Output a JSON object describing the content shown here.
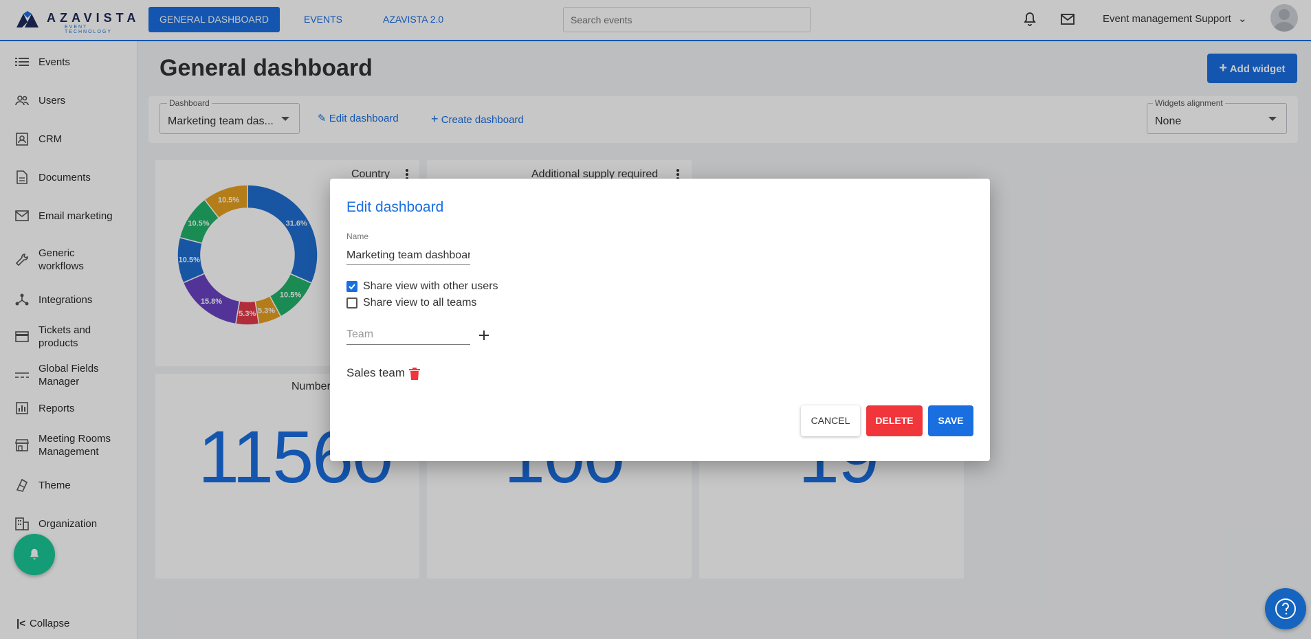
{
  "brand": {
    "name": "AZAVISTA",
    "tagline": "EVENT TECHNOLOGY"
  },
  "topnav": [
    {
      "label": "GENERAL DASHBOARD",
      "active": true
    },
    {
      "label": "EVENTS",
      "active": false
    },
    {
      "label": "AZAVISTA 2.0",
      "active": false
    }
  ],
  "search": {
    "placeholder": "Search events"
  },
  "user": {
    "name": "Event management Support"
  },
  "sidebar": {
    "items": [
      {
        "label": "Events",
        "icon": "list-icon"
      },
      {
        "label": "Users",
        "icon": "users-icon"
      },
      {
        "label": "CRM",
        "icon": "contact-card-icon"
      },
      {
        "label": "Documents",
        "icon": "document-icon"
      },
      {
        "label": "Email marketing",
        "icon": "mail-icon"
      },
      {
        "label": "Generic workflows",
        "icon": "wrench-icon"
      },
      {
        "label": "Integrations",
        "icon": "hub-icon"
      },
      {
        "label": "Tickets and products",
        "icon": "card-icon"
      },
      {
        "label": "Global Fields Manager",
        "icon": "fields-icon"
      },
      {
        "label": "Reports",
        "icon": "chart-icon"
      },
      {
        "label": "Meeting Rooms Management",
        "icon": "store-icon"
      },
      {
        "label": "Theme",
        "icon": "palette-icon"
      },
      {
        "label": "Organization",
        "icon": "building-icon"
      }
    ],
    "collapse": "Collapse"
  },
  "page": {
    "title": "General dashboard",
    "add_widget": "Add widget",
    "dashboard_select": {
      "caption": "Dashboard",
      "value": "Marketing team das..."
    },
    "edit_dashboard": "Edit dashboard",
    "create_dashboard": "Create dashboard",
    "alignment_select": {
      "caption": "Widgets alignment",
      "value": "None"
    }
  },
  "widgets": {
    "country": {
      "title": "Country"
    },
    "supply": {
      "title": "Additional supply required"
    },
    "number": {
      "title": "Number",
      "value": "11560"
    },
    "number2": {
      "value": "100"
    },
    "number3": {
      "value": "19"
    }
  },
  "chart_data": {
    "type": "pie",
    "title": "Country",
    "slices": [
      {
        "value": 31.6,
        "label": "31.6%",
        "color": "#1f6fd1"
      },
      {
        "value": 10.5,
        "label": "10.5%",
        "color": "#22b36b"
      },
      {
        "value": 5.3,
        "label": "5.3%",
        "color": "#e8a020"
      },
      {
        "value": 5.3,
        "label": "5.3%",
        "color": "#e23a4a"
      },
      {
        "value": 15.8,
        "label": "15.8%",
        "color": "#6a43c4"
      },
      {
        "value": 10.5,
        "label": "10.5%",
        "color": "#1f6fd1"
      },
      {
        "value": 10.5,
        "label": "10.5%",
        "color": "#22b36b"
      },
      {
        "value": 10.5,
        "label": "10.5%",
        "color": "#e8a020"
      }
    ]
  },
  "modal": {
    "title": "Edit dashboard",
    "name_caption": "Name",
    "name_value": "Marketing team dashboard",
    "share_users": {
      "label": "Share view with other users",
      "checked": true
    },
    "share_teams": {
      "label": "Share view to all teams",
      "checked": false
    },
    "team_placeholder": "Team",
    "teams": [
      "Sales team"
    ],
    "cancel": "CANCEL",
    "delete": "DELETE",
    "save": "SAVE"
  },
  "colors": {
    "accent": "#1a6fe0",
    "danger": "#f0363a",
    "notify": "#19c896"
  }
}
